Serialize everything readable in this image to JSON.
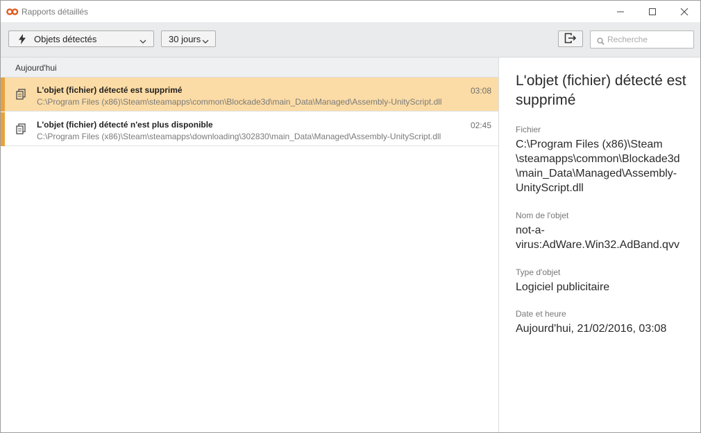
{
  "window": {
    "title": "Rapports détaillés"
  },
  "toolbar": {
    "filter_label": "Objets détectés",
    "period_label": "30 jours",
    "search_placeholder": "Recherche",
    "search_value": ""
  },
  "list": {
    "group_label": "Aujourd'hui",
    "rows": [
      {
        "title": "L'objet (fichier) détecté est supprimé",
        "path": "C:\\Program Files (x86)\\Steam\\steamapps\\common\\Blockade3d\\main_Data\\Managed\\Assembly-UnityScript.dll",
        "time": "03:08"
      },
      {
        "title": "L'objet (fichier) détecté n'est plus disponible",
        "path": "C:\\Program Files (x86)\\Steam\\steamapps\\downloading\\302830\\main_Data\\Managed\\Assembly-UnityScript.dll",
        "time": "02:45"
      }
    ]
  },
  "details": {
    "title": "L'objet (fichier) détecté est supprimé",
    "file_label": "Fichier",
    "file_value": "C:\\Program Files (x86)\\Steam\\steamapps\\common\\Blockade3d\\main_Data\\Managed\\Assembly-UnityScript.dll",
    "object_name_label": "Nom de l'objet",
    "object_name_value": "not-a-virus:AdWare.Win32.AdBand.qvv",
    "object_type_label": "Type d'objet",
    "object_type_value": "Logiciel publicitaire",
    "datetime_label": "Date et heure",
    "datetime_value": "Aujourd'hui, 21/02/2016, 03:08"
  },
  "colors": {
    "accent": "#e8a23c",
    "selected_row": "#fcdca6",
    "logo": "#e05a1e"
  },
  "icons": {
    "app": "kaspersky-logo-icon",
    "filter": "lightning-icon",
    "export": "export-icon",
    "search": "search-icon",
    "row": "documents-icon"
  }
}
